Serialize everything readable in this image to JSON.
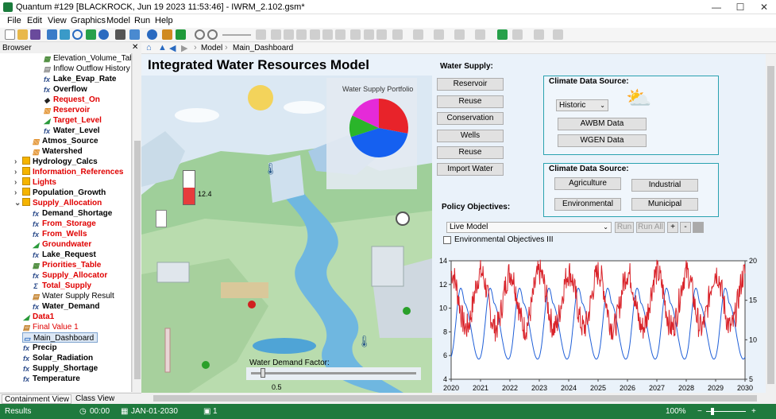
{
  "window": {
    "title": "Quantum #129 [BLACKROCK, Jun 19 2023 11:53:46] - IWRM_2.102.gsm*",
    "controls": [
      "—",
      "☐",
      "✕"
    ]
  },
  "menu": [
    "File",
    "Edit",
    "View",
    "Graphics",
    "Model",
    "Run",
    "Help"
  ],
  "browser": {
    "header": "Browser",
    "items": [
      {
        "label": "Elevation_Volume_Table",
        "style": "nrm",
        "icon": "table-icon",
        "indent": 54
      },
      {
        "label": "Inflow Outflow History",
        "style": "nrm",
        "icon": "history-icon",
        "indent": 54
      },
      {
        "label": "Lake_Evap_Rate",
        "style": "blk",
        "icon": "function-icon",
        "indent": 54
      },
      {
        "label": "Overflow",
        "style": "blk",
        "icon": "function-icon",
        "indent": 54
      },
      {
        "label": "Request_On",
        "style": "red",
        "icon": "diamond-icon",
        "indent": 54
      },
      {
        "label": "Reservoir",
        "style": "red",
        "icon": "reservoir-icon",
        "indent": 54
      },
      {
        "label": "Target_Level",
        "style": "red",
        "icon": "data-icon",
        "indent": 54
      },
      {
        "label": "Water_Level",
        "style": "blk",
        "icon": "function-icon",
        "indent": 54
      },
      {
        "label": "Atmos_Source",
        "style": "blk",
        "icon": "source-icon",
        "indent": 40
      },
      {
        "label": "Watershed",
        "style": "blk",
        "icon": "watershed-icon",
        "indent": 40
      },
      {
        "label": "Hydrology_Calcs",
        "style": "blk",
        "icon": "folder-icon",
        "indent": 28,
        "expand": "›"
      },
      {
        "label": "Information_References",
        "style": "red",
        "icon": "folder-icon",
        "indent": 28,
        "expand": "›"
      },
      {
        "label": "Lights",
        "style": "red",
        "icon": "folder-icon",
        "indent": 28,
        "expand": "›"
      },
      {
        "label": "Population_Growth",
        "style": "blk",
        "icon": "folder-icon",
        "indent": 28,
        "expand": "›"
      },
      {
        "label": "Supply_Allocation",
        "style": "red",
        "icon": "folder-icon",
        "indent": 28,
        "expand": "⌄"
      },
      {
        "label": "Demand_Shortage",
        "style": "blk",
        "icon": "function-icon",
        "indent": 40
      },
      {
        "label": "From_Storage",
        "style": "red",
        "icon": "function-icon",
        "indent": 40
      },
      {
        "label": "From_Wells",
        "style": "red",
        "icon": "function-icon",
        "indent": 40
      },
      {
        "label": "Groundwater",
        "style": "red",
        "icon": "data-icon",
        "indent": 40
      },
      {
        "label": "Lake_Request",
        "style": "blk",
        "icon": "function-icon",
        "indent": 40
      },
      {
        "label": "Priorities_Table",
        "style": "red",
        "icon": "table-icon",
        "indent": 40
      },
      {
        "label": "Supply_Allocator",
        "style": "red",
        "icon": "function-icon",
        "indent": 40
      },
      {
        "label": "Total_Supply",
        "style": "red",
        "icon": "sum-icon",
        "indent": 40
      },
      {
        "label": "Water Supply Result",
        "style": "nrm",
        "icon": "result-icon",
        "indent": 40
      },
      {
        "label": "Water_Demand",
        "style": "blk",
        "icon": "function-icon",
        "indent": 40
      },
      {
        "label": "Data1",
        "style": "red",
        "icon": "data-icon",
        "indent": 28
      },
      {
        "label": "Final Value 1",
        "style": "redn",
        "icon": "result-icon",
        "indent": 28
      },
      {
        "label": "Main_Dashboard",
        "style": "nrm",
        "icon": "dashboard-icon",
        "indent": 28,
        "selected": true
      },
      {
        "label": "Precip",
        "style": "blk",
        "icon": "function-icon",
        "indent": 28
      },
      {
        "label": "Solar_Radiation",
        "style": "blk",
        "icon": "function-icon",
        "indent": 28
      },
      {
        "label": "Supply_Shortage",
        "style": "blk",
        "icon": "function-icon",
        "indent": 28
      },
      {
        "label": "Temperature",
        "style": "blk",
        "icon": "function-icon",
        "indent": 28
      }
    ],
    "tabs": {
      "containment": "Containment View",
      "class": "Class View"
    }
  },
  "nav": {
    "breadcrumb": [
      "Model",
      "Main_Dashboard"
    ]
  },
  "dashboard": {
    "title": "Integrated Water Resources Model",
    "portfolio_title": "Water Supply Portfolio",
    "pie": [
      {
        "color": "#e8232a",
        "value": 0.28
      },
      {
        "color": "#1560f0",
        "value": 0.42
      },
      {
        "color": "#2ab52a",
        "value": 0.12
      },
      {
        "color": "#e52ad8",
        "value": 0.18
      }
    ],
    "storage_value": "12.4",
    "storage_fill": 0.5,
    "water_supply_label": "Water Supply:",
    "supply_buttons": [
      "Reservoir",
      "Reuse",
      "Conservation",
      "Wells",
      "Reuse",
      "Import Water"
    ],
    "climate1_label": "Climate Data Source:",
    "climate_select": "Historic",
    "climate1_buttons": [
      "AWBM Data",
      "WGEN Data"
    ],
    "climate2_label": "Climate Data Source:",
    "climate2_buttons": [
      "Agriculture",
      "Industrial",
      "Environmental",
      "Municipal"
    ],
    "policy_label": "Policy Objectives:",
    "model_select": "Live Model",
    "run_buttons": [
      "Run",
      "Run All",
      "+",
      "-"
    ],
    "env_checkbox": "Environmental Objectives III",
    "demand_label": "Water Demand Factor:",
    "demand_value": "0.5",
    "demand_fraction": 0.5
  },
  "status": {
    "results": "Results",
    "time": "00:00",
    "date": "JAN-01-2030",
    "counter": "1",
    "zoom": "100%"
  },
  "chart_data": {
    "type": "line",
    "x_ticks": [
      "2020",
      "2021",
      "2022",
      "2023",
      "2024",
      "2025",
      "2026",
      "2027",
      "2028",
      "2029",
      "2030"
    ],
    "xlim": [
      2020,
      2030
    ],
    "left_ticks": [
      "4",
      "6",
      "8",
      "10",
      "12",
      "14"
    ],
    "ylim_left": [
      4,
      14
    ],
    "right_ticks": [
      "5",
      "10",
      "15",
      "20"
    ],
    "ylim_right": [
      5,
      20
    ],
    "series": [
      {
        "axis": "left",
        "color": "#1f5fd8",
        "shape": "seasonal",
        "period": 1,
        "min": 5.7,
        "max": 13.6
      },
      {
        "axis": "right",
        "color": "#d9232a",
        "shape": "noisy",
        "mean": 15,
        "amplitude": 3.5
      }
    ]
  }
}
